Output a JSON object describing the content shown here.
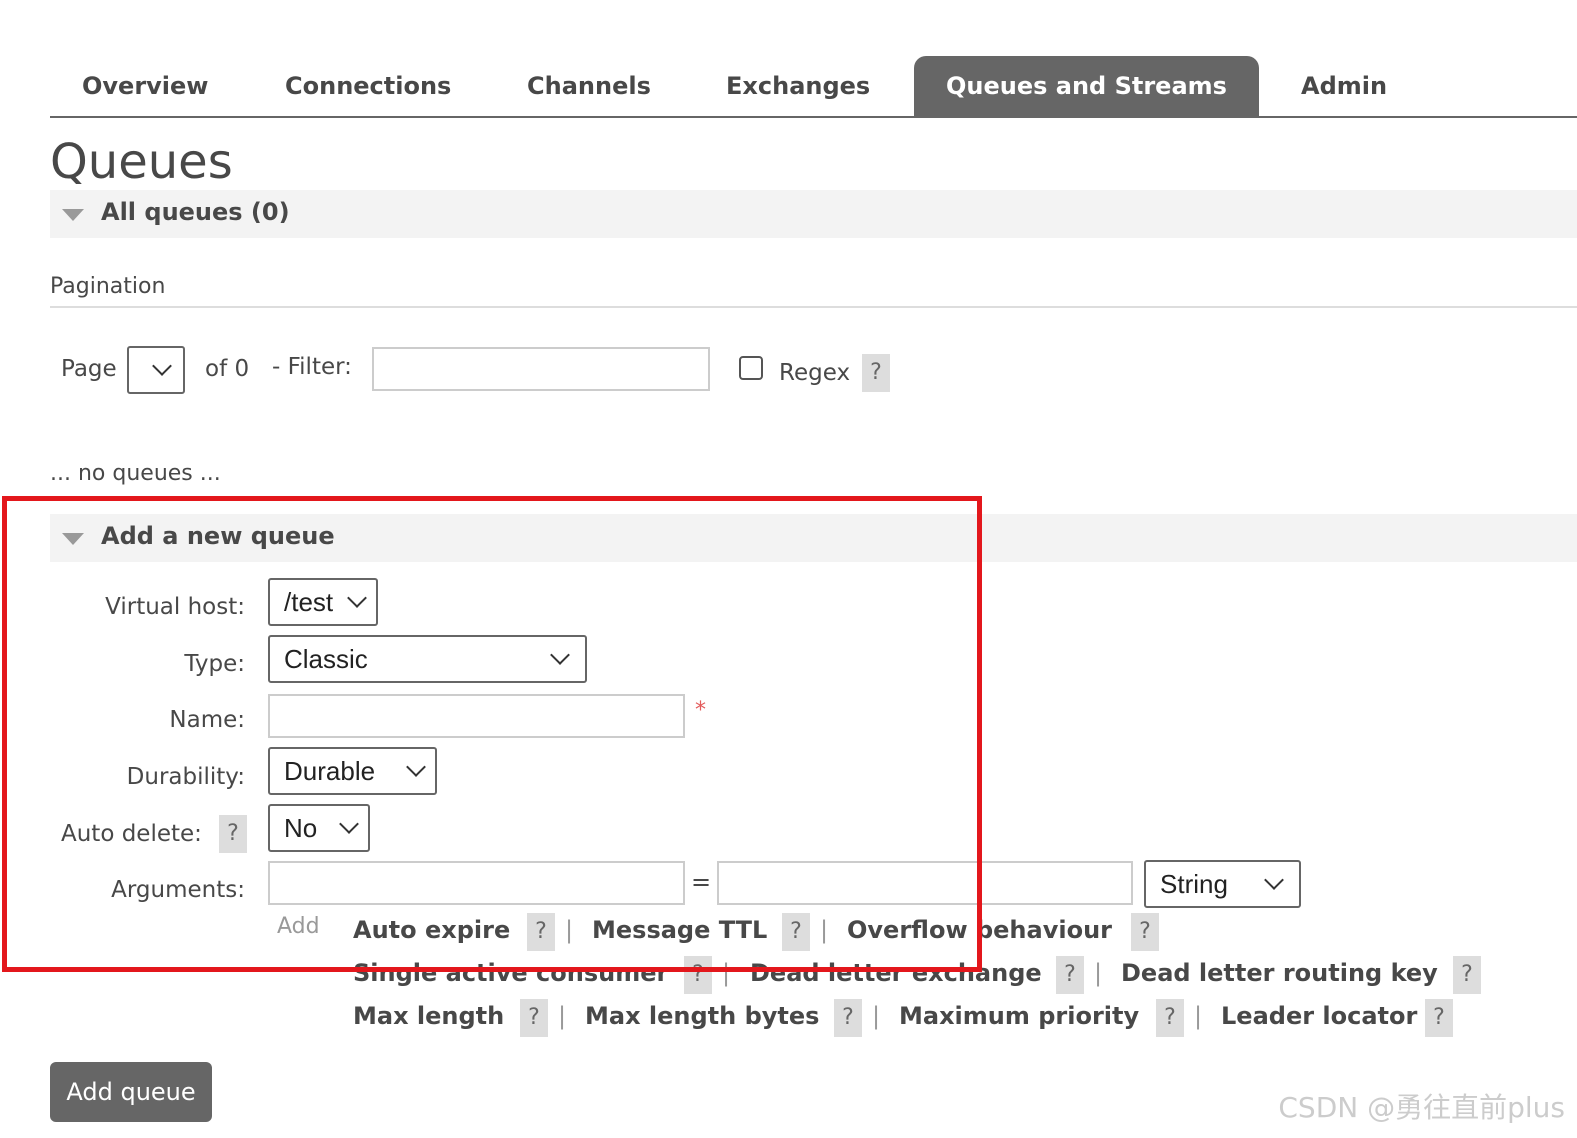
{
  "nav": {
    "tabs": [
      "Overview",
      "Connections",
      "Channels",
      "Exchanges",
      "Queues and Streams",
      "Admin"
    ],
    "active": "Queues and Streams"
  },
  "page_title": "Queues",
  "all_queues": {
    "title": "All queues (0)"
  },
  "pagination": {
    "label": "Pagination",
    "page_label": "Page",
    "page_value": "",
    "of_text": "of 0",
    "filter_label": "- Filter:",
    "filter_value": "",
    "regex_label": "Regex",
    "regex_checked": false,
    "help": "?"
  },
  "no_queues_text": "... no queues ...",
  "add_queue": {
    "title": "Add a new queue",
    "fields": {
      "vhost": {
        "label": "Virtual host:",
        "value": "/test"
      },
      "type": {
        "label": "Type:",
        "value": "Classic"
      },
      "name": {
        "label": "Name:",
        "value": "",
        "required": "*"
      },
      "durability": {
        "label": "Durability:",
        "value": "Durable"
      },
      "auto_delete": {
        "label": "Auto delete:",
        "value": "No",
        "help": "?"
      },
      "arguments": {
        "label": "Arguments:",
        "key": "",
        "equals": "=",
        "value": "",
        "type": "String"
      }
    },
    "add_label": "Add",
    "arg_links": {
      "auto_expire": "Auto expire",
      "message_ttl": "Message TTL",
      "overflow": "Overflow behaviour",
      "single_active": "Single active consumer",
      "dlx": "Dead letter exchange",
      "dlrk": "Dead letter routing key",
      "max_length": "Max length",
      "max_length_bytes": "Max length bytes",
      "max_priority": "Maximum priority",
      "leader_locator": "Leader locator"
    },
    "help": "?",
    "sep": "|",
    "submit": "Add queue"
  },
  "watermark": "CSDN @勇往直前plus",
  "colors": {
    "active_tab": "#666666",
    "highlight_box": "#e3171c",
    "required": "#e35a5a"
  }
}
